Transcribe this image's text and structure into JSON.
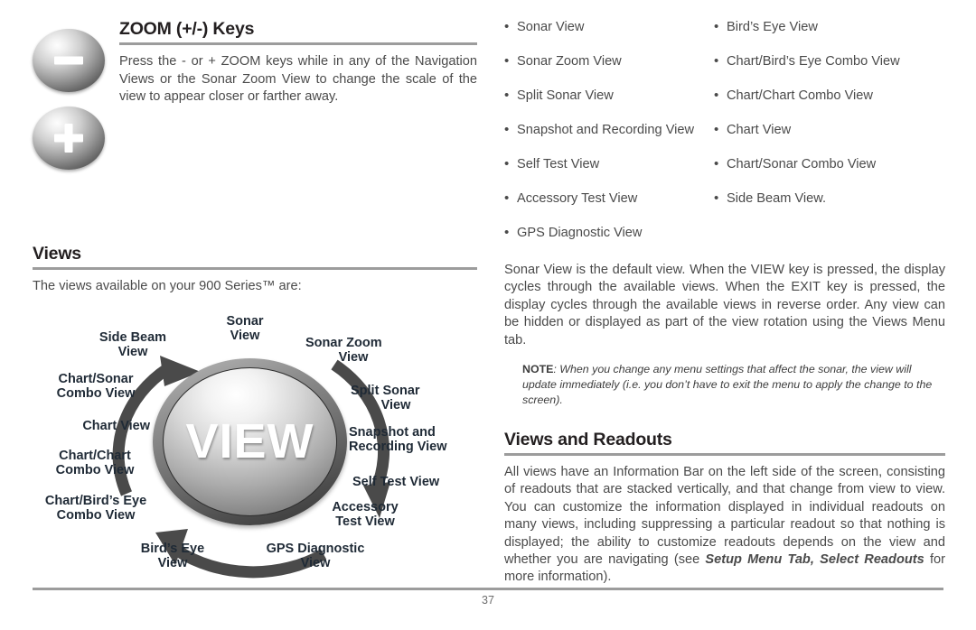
{
  "left_column": {
    "zoom_section": {
      "heading": "ZOOM (+/-) Keys",
      "body": "Press the - or + ZOOM keys while in any of the Navigation Views or the Sonar Zoom View to change the scale of the view to appear closer or farther away.",
      "minus_key_label": "minus",
      "plus_key_label": "plus"
    },
    "views_section": {
      "heading": "Views",
      "intro": "The views available on your 900 Series™ are:"
    }
  },
  "diagram": {
    "center_label": "VIEW",
    "labels": {
      "sonar_view": "Sonar\nView",
      "sonar_zoom_view": "Sonar Zoom\nView",
      "split_sonar_view": "Split Sonar\nView",
      "snapshot_recording_view": "Snapshot and\nRecording View",
      "self_test_view": "Self Test View",
      "accessory_test_view": "Accessory\nTest View",
      "gps_diagnostic_view": "GPS Diagnostic\nView",
      "birds_eye_view": "Bird’s Eye\nView",
      "chart_birds_eye_combo_view": "Chart/Bird’s Eye\nCombo View",
      "chart_chart_combo_view": "Chart/Chart\nCombo View",
      "chart_view": "Chart View",
      "chart_sonar_combo_view": "Chart/Sonar\nCombo View",
      "side_beam_view": "Side Beam\nView"
    },
    "arc_color": "#4a4a4a"
  },
  "right_column": {
    "view_list_col1": [
      "Sonar View",
      "Sonar Zoom View",
      "Split Sonar View",
      "Snapshot and Recording View",
      "Self Test View",
      "Accessory Test View",
      "GPS Diagnostic View"
    ],
    "view_list_col2": [
      "Bird’s Eye View",
      "Chart/Bird’s Eye Combo View",
      "Chart/Chart Combo View",
      "Chart View",
      "Chart/Sonar Combo View",
      "Side Beam View."
    ],
    "default_view_paragraph": "Sonar View is the default view. When the VIEW key is pressed, the display cycles through the available views. When the EXIT key is pressed, the display cycles through the available views in reverse order. Any view can be hidden or displayed as part of the view rotation using the Views Menu tab.",
    "note": {
      "label": "NOTE",
      "text": ": When you change any menu settings that affect the sonar, the view will update immediately (i.e. you don’t have to exit the menu to apply the change to the screen)."
    },
    "readouts_section": {
      "heading": "Views and Readouts",
      "body_part1": "All views have an Information Bar on the left side of the screen, consisting of readouts that are stacked vertically, and that change from view to view. You can customize the information displayed in individual readouts on many views, including suppressing a particular readout so that nothing is displayed; the ability to customize readouts depends on the view and whether you are navigating (see ",
      "body_emphasis": "Setup Menu Tab, Select Readouts",
      "body_part2": " for more information)."
    }
  },
  "footer": {
    "page_number": "37"
  }
}
